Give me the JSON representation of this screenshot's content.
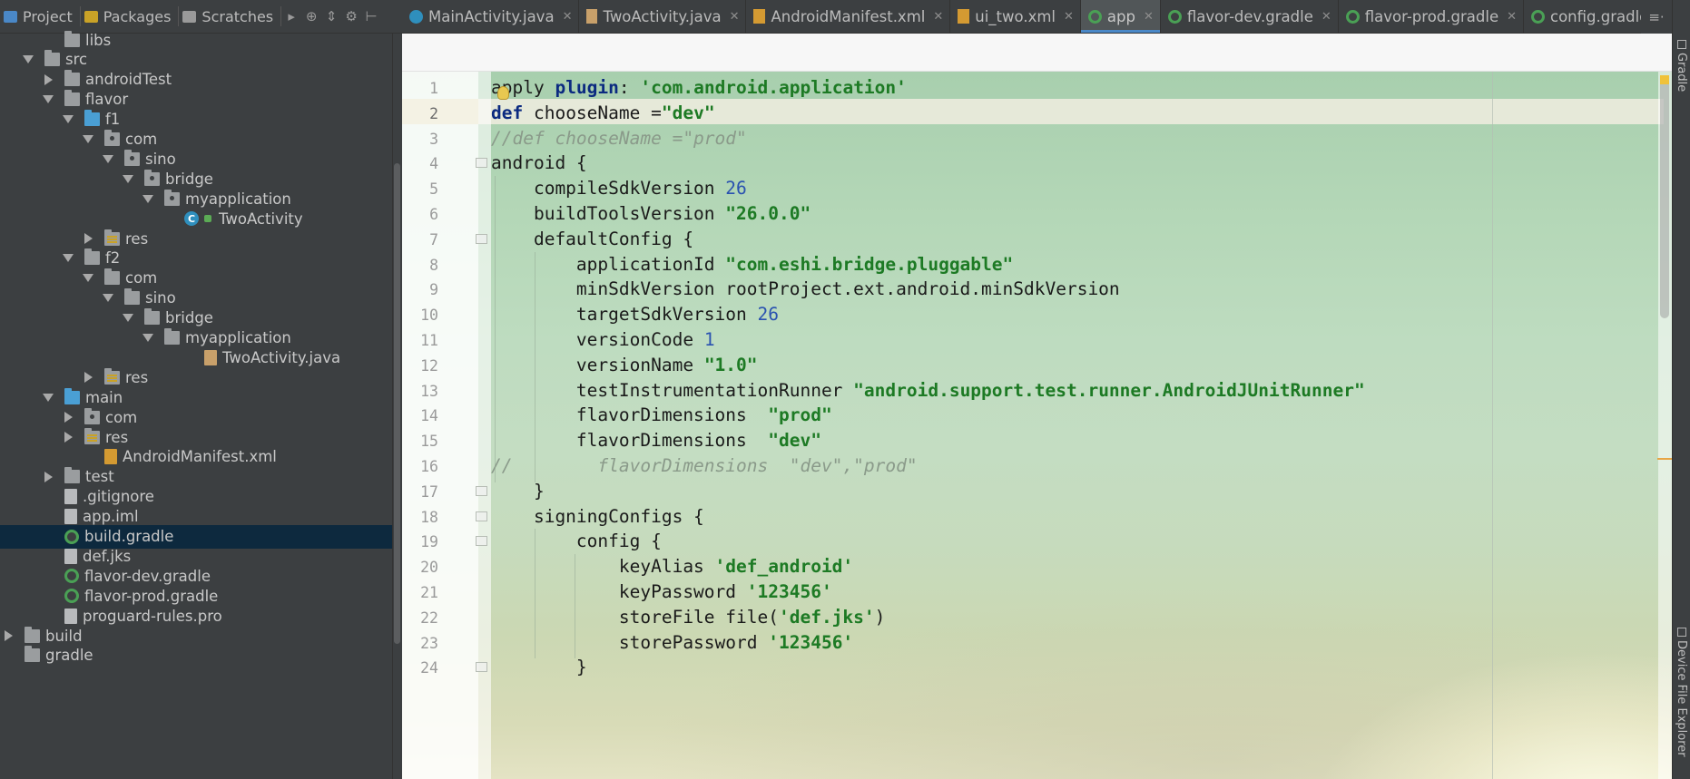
{
  "left_panel": {
    "tabs": [
      {
        "label": "Project",
        "icon": "project-icon",
        "color": "#4a88c7"
      },
      {
        "label": "Packages",
        "icon": "packages-icon",
        "color": "#c9a227"
      },
      {
        "label": "Scratches",
        "icon": "scratches-icon",
        "color": "#9a9a9a"
      }
    ],
    "tools": [
      "expand-more-icon",
      "target-icon",
      "collapse-all-icon",
      "settings-icon",
      "hide-panel-icon"
    ],
    "tree": [
      {
        "label": "libs",
        "depth": 2,
        "arrow": "none",
        "icon": "folder"
      },
      {
        "label": "src",
        "depth": 1,
        "arrow": "open",
        "icon": "folder"
      },
      {
        "label": "androidTest",
        "depth": 2,
        "arrow": "closed",
        "icon": "folder"
      },
      {
        "label": "flavor",
        "depth": 2,
        "arrow": "open",
        "icon": "folder"
      },
      {
        "label": "f1",
        "depth": 3,
        "arrow": "open",
        "icon": "folder-blue"
      },
      {
        "label": "com",
        "depth": 4,
        "arrow": "open",
        "icon": "folder-pkg"
      },
      {
        "label": "sino",
        "depth": 5,
        "arrow": "open",
        "icon": "folder-pkg"
      },
      {
        "label": "bridge",
        "depth": 6,
        "arrow": "open",
        "icon": "folder-pkg"
      },
      {
        "label": "myapplication",
        "depth": 7,
        "arrow": "open",
        "icon": "folder-pkg"
      },
      {
        "label": "TwoActivity",
        "depth": 8,
        "arrow": "none",
        "icon": "class"
      },
      {
        "label": "res",
        "depth": 4,
        "arrow": "closed",
        "icon": "folder-res"
      },
      {
        "label": "f2",
        "depth": 3,
        "arrow": "open",
        "icon": "folder"
      },
      {
        "label": "com",
        "depth": 4,
        "arrow": "open",
        "icon": "folder"
      },
      {
        "label": "sino",
        "depth": 5,
        "arrow": "open",
        "icon": "folder"
      },
      {
        "label": "bridge",
        "depth": 6,
        "arrow": "open",
        "icon": "folder"
      },
      {
        "label": "myapplication",
        "depth": 7,
        "arrow": "open",
        "icon": "folder"
      },
      {
        "label": "TwoActivity.java",
        "depth": 9,
        "arrow": "none",
        "icon": "file-java"
      },
      {
        "label": "res",
        "depth": 4,
        "arrow": "closed",
        "icon": "folder-res"
      },
      {
        "label": "main",
        "depth": 2,
        "arrow": "open",
        "icon": "folder-blue"
      },
      {
        "label": "com",
        "depth": 3,
        "arrow": "closed",
        "icon": "folder-pkg"
      },
      {
        "label": "res",
        "depth": 3,
        "arrow": "closed",
        "icon": "folder-res"
      },
      {
        "label": "AndroidManifest.xml",
        "depth": 4,
        "arrow": "none",
        "icon": "file-xml"
      },
      {
        "label": "test",
        "depth": 2,
        "arrow": "closed",
        "icon": "folder"
      },
      {
        "label": ".gitignore",
        "depth": 2,
        "arrow": "none",
        "icon": "file"
      },
      {
        "label": "app.iml",
        "depth": 2,
        "arrow": "none",
        "icon": "file"
      },
      {
        "label": "build.gradle",
        "depth": 2,
        "arrow": "none",
        "icon": "gradle",
        "selected": true
      },
      {
        "label": "def.jks",
        "depth": 2,
        "arrow": "none",
        "icon": "file"
      },
      {
        "label": "flavor-dev.gradle",
        "depth": 2,
        "arrow": "none",
        "icon": "gradle"
      },
      {
        "label": "flavor-prod.gradle",
        "depth": 2,
        "arrow": "none",
        "icon": "gradle"
      },
      {
        "label": "proguard-rules.pro",
        "depth": 2,
        "arrow": "none",
        "icon": "file"
      },
      {
        "label": "build",
        "depth": 0,
        "arrow": "closed",
        "icon": "folder"
      },
      {
        "label": "gradle",
        "depth": 0,
        "arrow": "none",
        "icon": "folder"
      }
    ]
  },
  "editor": {
    "tabs": [
      {
        "label": "MainActivity.java",
        "icon": "java-class-icon",
        "active": false
      },
      {
        "label": "TwoActivity.java",
        "icon": "java-file-icon",
        "active": false
      },
      {
        "label": "AndroidManifest.xml",
        "icon": "xml-file-icon",
        "active": false
      },
      {
        "label": "ui_two.xml",
        "icon": "xml-file-icon",
        "active": false
      },
      {
        "label": "app",
        "icon": "gradle-icon",
        "active": true
      },
      {
        "label": "flavor-dev.gradle",
        "icon": "gradle-icon",
        "active": false
      },
      {
        "label": "flavor-prod.gradle",
        "icon": "gradle-icon",
        "active": false
      },
      {
        "label": "config.gradle",
        "icon": "gradle-icon",
        "active": false
      }
    ],
    "tabs_menu": "≡·",
    "current_line": 2,
    "lines": [
      [
        [
          "plain",
          "apply "
        ],
        [
          "kw",
          "plugin"
        ],
        [
          "plain",
          ": "
        ],
        [
          "str",
          "'com.android.application'"
        ]
      ],
      [
        [
          "kw",
          "def "
        ],
        [
          "plain",
          "chooseName ="
        ],
        [
          "str",
          "\"dev\""
        ]
      ],
      [
        [
          "cmt",
          "//def chooseName =\"prod\""
        ]
      ],
      [
        [
          "plain",
          "android {"
        ]
      ],
      [
        [
          "plain",
          "    compileSdkVersion "
        ],
        [
          "num",
          "26"
        ]
      ],
      [
        [
          "plain",
          "    buildToolsVersion "
        ],
        [
          "str",
          "\"26.0.0\""
        ]
      ],
      [
        [
          "plain",
          "    defaultConfig {"
        ]
      ],
      [
        [
          "plain",
          "        applicationId "
        ],
        [
          "str",
          "\"com.eshi.bridge.pluggable\""
        ]
      ],
      [
        [
          "plain",
          "        minSdkVersion rootProject.ext.android.minSdkVersion"
        ]
      ],
      [
        [
          "plain",
          "        targetSdkVersion "
        ],
        [
          "num",
          "26"
        ]
      ],
      [
        [
          "plain",
          "        versionCode "
        ],
        [
          "num",
          "1"
        ]
      ],
      [
        [
          "plain",
          "        versionName "
        ],
        [
          "str",
          "\"1.0\""
        ]
      ],
      [
        [
          "plain",
          "        testInstrumentationRunner "
        ],
        [
          "str",
          "\"android.support.test.runner.AndroidJUnitRunner\""
        ]
      ],
      [
        [
          "plain",
          "        flavorDimensions  "
        ],
        [
          "str",
          "\"prod\""
        ]
      ],
      [
        [
          "plain",
          "        flavorDimensions  "
        ],
        [
          "str",
          "\"dev\""
        ]
      ],
      [
        [
          "cmt",
          "//        flavorDimensions  \"dev\",\"prod\""
        ]
      ],
      [
        [
          "plain",
          "    }"
        ]
      ],
      [
        [
          "plain",
          "    signingConfigs {"
        ]
      ],
      [
        [
          "plain",
          "        config {"
        ]
      ],
      [
        [
          "plain",
          "            keyAlias "
        ],
        [
          "str",
          "'def_android'"
        ]
      ],
      [
        [
          "plain",
          "            keyPassword "
        ],
        [
          "str",
          "'123456'"
        ]
      ],
      [
        [
          "plain",
          "            storeFile file("
        ],
        [
          "str",
          "'def.jks'"
        ],
        [
          "plain",
          ")"
        ]
      ],
      [
        [
          "plain",
          "            storePassword "
        ],
        [
          "str",
          "'123456'"
        ]
      ],
      [
        [
          "plain",
          "        }"
        ]
      ]
    ]
  },
  "right_strip": {
    "gradle_label": "Gradle",
    "device_explorer_label": "Device File Explorer"
  }
}
